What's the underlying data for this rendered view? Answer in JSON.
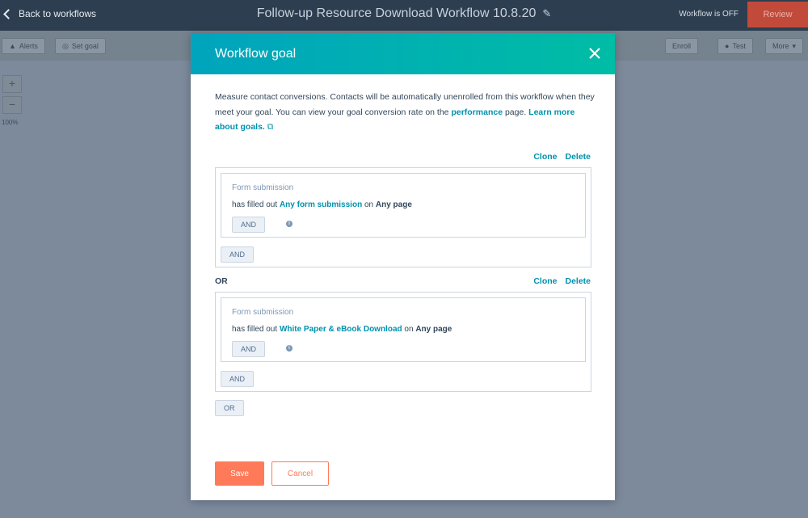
{
  "header": {
    "back_label": "Back to workflows",
    "title": "Follow-up Resource Download Workflow 10.8.20",
    "status": "Workflow is OFF",
    "review_label": "Review"
  },
  "toolbar": {
    "alerts_label": "Alerts",
    "set_goal_label": "Set goal",
    "enroll_label": "Enroll",
    "test_label": "Test",
    "more_label": "More",
    "zoom_in": "+",
    "zoom_out": "−",
    "zoom_level": "100%"
  },
  "modal": {
    "title": "Workflow goal",
    "desc_part1": "Measure contact conversions. Contacts will be automatically unenrolled from this workflow when they meet your goal. You can view your goal conversion rate on the ",
    "desc_link1": "performance",
    "desc_part2": " page. ",
    "desc_link2": "Learn more about goals.",
    "clone_label": "Clone",
    "delete_label": "Delete",
    "or_label": "OR",
    "groups": [
      {
        "filter_label": "Form submission",
        "prefix": "has filled out ",
        "form": "Any form submission",
        "middle": " on ",
        "page": "Any page",
        "inner_and": "AND",
        "outer_and": "AND"
      },
      {
        "filter_label": "Form submission",
        "prefix": "has filled out ",
        "form": "White Paper & eBook Download",
        "middle": " on ",
        "page": "Any page",
        "inner_and": "AND",
        "outer_and": "AND"
      }
    ],
    "or_button": "OR",
    "save_label": "Save",
    "cancel_label": "Cancel"
  },
  "colors": {
    "accent": "#0091ae",
    "primary_button": "#ff7a59",
    "header_gradient_start": "#00a4bd",
    "header_gradient_end": "#00bda5"
  }
}
